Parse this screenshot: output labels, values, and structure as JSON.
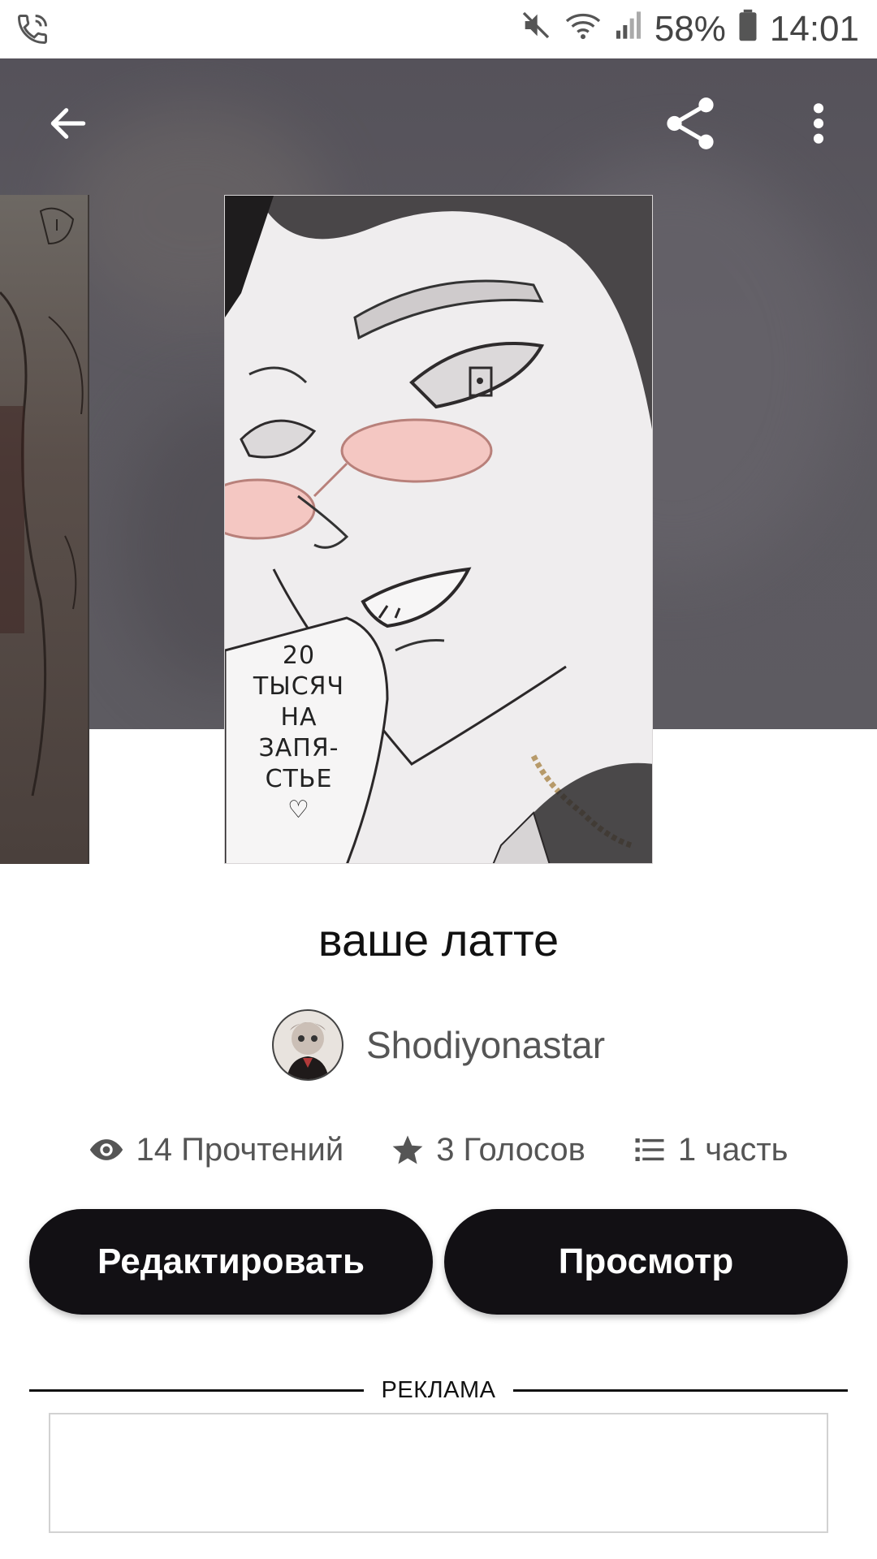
{
  "status_bar": {
    "battery": "58%",
    "time": "14:01",
    "icons": [
      "phone-call-icon",
      "mute-icon",
      "wifi-icon",
      "signal-icon",
      "battery-icon"
    ]
  },
  "toolbar": {
    "back_icon": "back-arrow-icon",
    "share_icon": "share-icon",
    "menu_icon": "more-vert-icon"
  },
  "cover_text": {
    "line1": "20",
    "line2": "ТЫСЯЧ",
    "line3": "НА",
    "line4": "ЗАПЯ-",
    "line5": "СТЬЕ",
    "line6": "♡"
  },
  "story": {
    "title": "ваше латте",
    "author": "Shodiyonastar"
  },
  "stats": {
    "reads": "14 Прочтений",
    "votes": "3 Голосов",
    "parts": "1 часть"
  },
  "actions": {
    "edit_label": "Редактировать",
    "view_label": "Просмотр"
  },
  "ad": {
    "label": "РЕКЛАМА"
  },
  "colors": {
    "header_bg": "#5c5960",
    "button_bg": "#121014",
    "button_text": "#ffffff"
  }
}
